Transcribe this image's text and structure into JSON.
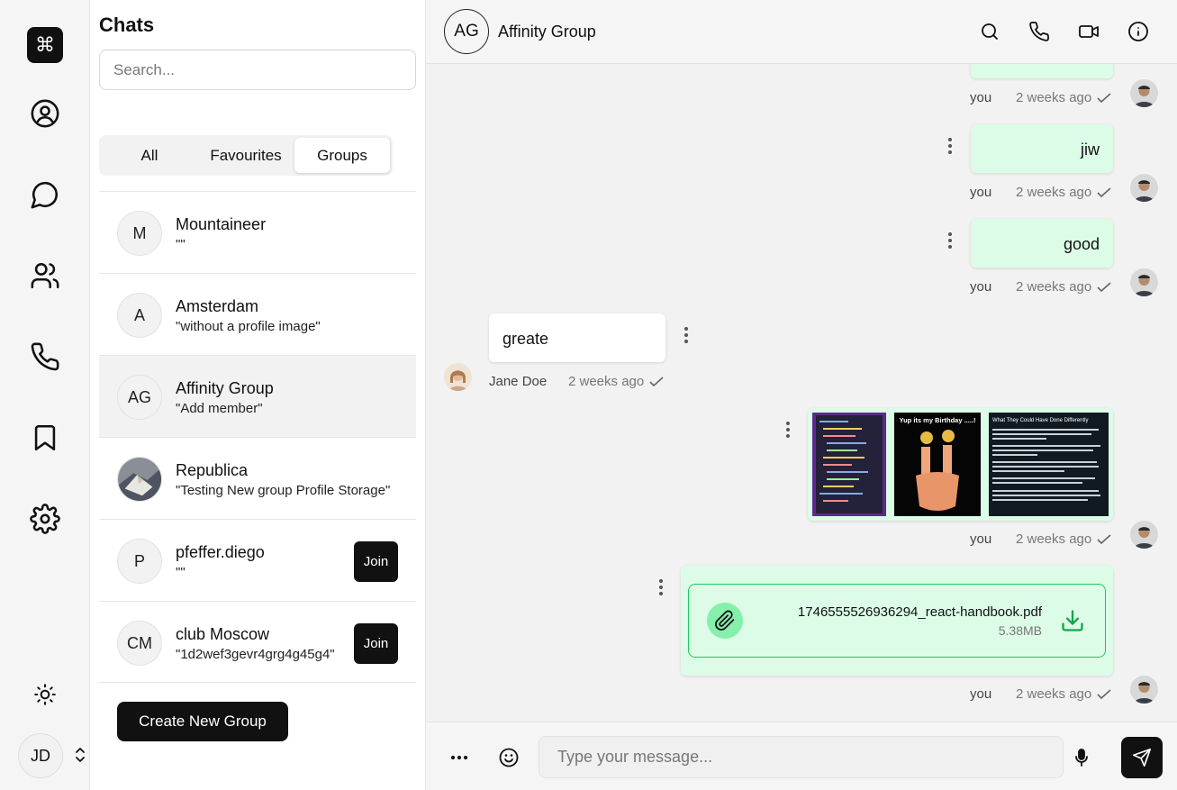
{
  "rail": {
    "logo_glyph": "⌘",
    "user_initials": "JD",
    "icons": [
      "profile-icon",
      "chat-bubble-icon",
      "users-icon",
      "phone-icon",
      "bookmark-icon",
      "settings-icon",
      "sun-icon",
      "chevrons-up-down-icon"
    ]
  },
  "panel": {
    "title": "Chats",
    "search_placeholder": "Search...",
    "tabs": [
      {
        "label": "All",
        "active": false
      },
      {
        "label": "Favourites",
        "active": false
      },
      {
        "label": "Groups",
        "active": true
      }
    ],
    "chats": [
      {
        "initials": "M",
        "name": "Mountaineer",
        "subtitle": "\"\"",
        "join": null,
        "selected": false
      },
      {
        "initials": "A",
        "name": "Amsterdam",
        "subtitle": "\"without a profile image\"",
        "join": null,
        "selected": false
      },
      {
        "initials": "AG",
        "name": "Affinity Group",
        "subtitle": "\"Add member\"",
        "join": null,
        "selected": true
      },
      {
        "initials": "",
        "name": "Republica",
        "subtitle": "\"Testing New group Profile Storage\"",
        "join": null,
        "selected": false
      },
      {
        "initials": "P",
        "name": "pfeffer.diego",
        "subtitle": "\"\"",
        "join": "Join",
        "selected": false
      },
      {
        "initials": "CM",
        "name": "club Moscow",
        "subtitle": "\"1d2wef3gevr4grg4g45g4\"",
        "join": "Join",
        "selected": false
      }
    ],
    "create_button": "Create New Group"
  },
  "conversation": {
    "avatar_initials": "AG",
    "name": "Affinity Group",
    "header_icons": [
      "search-icon",
      "phone-icon",
      "video-icon",
      "info-icon"
    ],
    "messages": [
      {
        "direction": "out",
        "text": "",
        "sender": "you",
        "time": "2 weeks ago"
      },
      {
        "direction": "out",
        "text": "jiw",
        "sender": "you",
        "time": "2 weeks ago"
      },
      {
        "direction": "out",
        "text": "good",
        "sender": "you",
        "time": "2 weeks ago"
      },
      {
        "direction": "in",
        "text": "greate",
        "sender": "Jane Doe",
        "time": "2 weeks ago"
      },
      {
        "direction": "out",
        "type": "images",
        "sender": "you",
        "time": "2 weeks ago",
        "images": [
          {
            "caption": "code screenshot"
          },
          {
            "caption": "Yup its my Birthday .....!"
          },
          {
            "caption": "What They Could Have Done Differently"
          }
        ]
      },
      {
        "direction": "out",
        "type": "file",
        "file_name": "1746555526936294_react-handbook.pdf",
        "file_size": "5.38MB",
        "sender": "you",
        "time": "2 weeks ago"
      }
    ],
    "composer_placeholder": "Type your message..."
  },
  "colors": {
    "outgoing_bubble": "#dcfce7",
    "file_border": "#22c55e",
    "accent_dark": "#111111"
  }
}
